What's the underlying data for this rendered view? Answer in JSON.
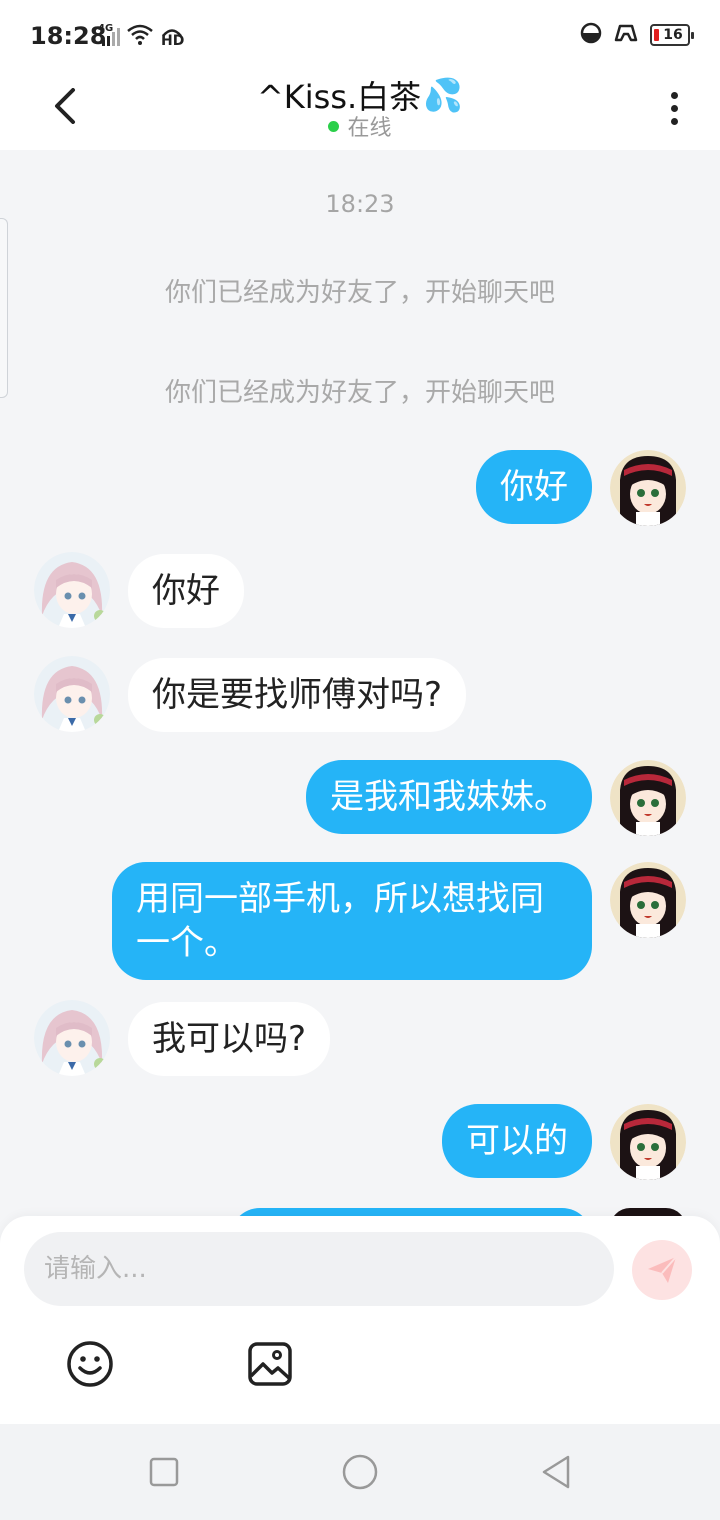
{
  "status_bar": {
    "time": "18:28",
    "network": "4G",
    "hd": "HD",
    "battery": "16"
  },
  "header": {
    "title": "^Kiss.白茶",
    "title_emoji": "💦",
    "status": "在线"
  },
  "chat": {
    "timestamp": "18:23",
    "system_messages": [
      "你们已经成为好友了，开始聊天吧",
      "你们已经成为好友了，开始聊天吧"
    ],
    "messages": [
      {
        "side": "out",
        "text": "你好"
      },
      {
        "side": "in",
        "text": "你好"
      },
      {
        "side": "in",
        "text": "你是要找师傅对吗?"
      },
      {
        "side": "out",
        "text": "是我和我妹妹。"
      },
      {
        "side": "out",
        "text": "用同一部手机，所以想找同一个。"
      },
      {
        "side": "in",
        "text": "我可以吗?"
      },
      {
        "side": "out",
        "text": "可以的"
      }
    ]
  },
  "composer": {
    "placeholder": "请输入...",
    "value": ""
  },
  "colors": {
    "outgoing_bubble": "#25b4f7",
    "incoming_bubble": "#ffffff",
    "online_dot": "#2bcf4a",
    "send_button": "#fde2e2"
  },
  "icons": [
    "back-arrow-icon",
    "more-vertical-icon",
    "emoji-icon",
    "image-icon",
    "send-icon",
    "nav-square-icon",
    "nav-circle-icon",
    "nav-triangle-icon"
  ]
}
